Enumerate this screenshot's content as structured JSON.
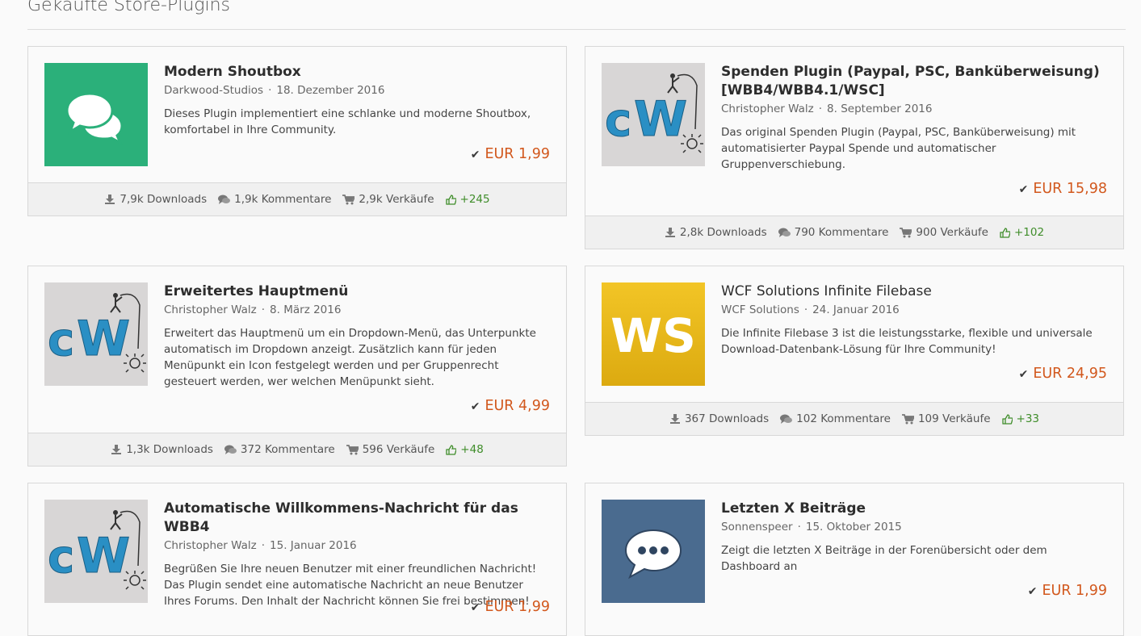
{
  "section_title": "Gekaufte Store-Plugins",
  "colors": {
    "price": "#d2581d",
    "likes": "#3f8d2a",
    "shoutbox_bg": "#2bb07a",
    "ws_bg": "#e8b712",
    "chat_bg": "#4a6b8f"
  },
  "plugins": [
    {
      "title": "Modern Shoutbox",
      "author": "Darkwood-Studios",
      "date": "18. Dezember 2016",
      "description": "Dieses Plugin implementiert eine schlanke und moderne Shoutbox, komfortabel in Ihre Community.",
      "price": "EUR 1,99",
      "downloads": "7,9k Downloads",
      "comments": "1,9k Kommentare",
      "sales": "2,9k Verkäufe",
      "likes": "+245",
      "icon": "chat-bubbles-icon"
    },
    {
      "title": "Spenden Plugin (Paypal, PSC, Banküberweisung) [WBB4/WBB4.1/WSC]",
      "author": "Christopher Walz",
      "date": "8. September 2016",
      "description": "Das original Spenden Plugin (Paypal, PSC, Banküberweisung) mit automatisierter Paypal Spende und automatischer Gruppenverschiebung.",
      "price": "EUR 15,98",
      "downloads": "2,8k Downloads",
      "comments": "790 Kommentare",
      "sales": "900 Verkäufe",
      "likes": "+102",
      "icon": "cw-logo-icon"
    },
    {
      "title": "Erweitertes Hauptmenü",
      "author": "Christopher Walz",
      "date": "8. März 2016",
      "description": "Erweitert das Hauptmenü um ein Dropdown-Menü, das Unterpunkte automatisch im Dropdown anzeigt. Zusätzlich kann für jeden Menüpunkt ein Icon festgelegt werden und per Gruppenrecht gesteuert werden, wer welchen Menüpunkt sieht.",
      "price": "EUR 4,99",
      "downloads": "1,3k Downloads",
      "comments": "372 Kommentare",
      "sales": "596 Verkäufe",
      "likes": "+48",
      "icon": "cw-logo-icon"
    },
    {
      "title": "WCF Solutions Infinite Filebase",
      "author": "WCF Solutions",
      "date": "24. Januar 2016",
      "description": "Die Infinite Filebase 3 ist die leistungsstarke, flexible und universale Download-Datenbank-Lösung für Ihre Community!",
      "price": "EUR 24,95",
      "downloads": "367 Downloads",
      "comments": "102 Kommentare",
      "sales": "109 Verkäufe",
      "likes": "+33",
      "icon": "ws-logo-icon",
      "logo_text": "WS"
    },
    {
      "title": "Automatische Willkommens-Nachricht für das WBB4",
      "author": "Christopher Walz",
      "date": "15. Januar 2016",
      "description": "Begrüßen Sie Ihre neuen Benutzer mit einer freundlichen Nachricht! Das Plugin sendet eine automatische Nachricht an neue Benutzer Ihres Forums. Den Inhalt der Nachricht können Sie frei bestimmen!",
      "price": "EUR 1,99",
      "icon": "cw-logo-icon"
    },
    {
      "title": "Letzten X Beiträge",
      "author": "Sonnenspeer",
      "date": "15. Oktober 2015",
      "description": "Zeigt die letzten X Beiträge in der Forenübersicht oder dem Dashboard an",
      "price": "EUR 1,99",
      "icon": "speech-bubble-dots-icon"
    }
  ]
}
